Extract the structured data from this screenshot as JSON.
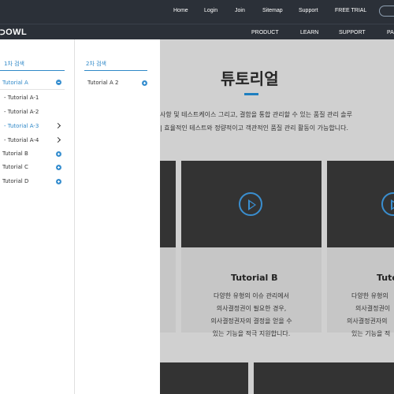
{
  "topbar": {
    "links": [
      "Home",
      "Login",
      "Join",
      "Sitemap",
      "Support",
      "FREE TRIAL"
    ]
  },
  "mainnav": {
    "logo": "OWL",
    "items": [
      "PRODUCT",
      "LEARN",
      "SUPPORT",
      "PA"
    ]
  },
  "page": {
    "title": "튜토리얼",
    "desc_line1": "사항 및 테스트케이스 그리고, 결함을 통합 관리할 수 있는 품질 관리 솔루",
    "desc_line2": "| 효율적인 테스트와 정량적이고 객관적인 품질 관리 활동이 가능합니다.",
    "cards": [
      {
        "title": "Tutorial B",
        "lines": [
          "다양한 유형의 이슈 관리에서",
          "의사결정권이 필요한 경우,",
          "의사결정권자의 결정을 얻을 수",
          "있는 기능을 적극 지원합니다."
        ]
      },
      {
        "title": "Tuto",
        "lines": [
          "다양한 유형의",
          "의사결정권이",
          "의사결정권자의",
          "있는 기능을 적"
        ]
      }
    ]
  },
  "menu1": {
    "heading": "1차 검색",
    "items": [
      {
        "label": "Tutorial A",
        "active": true,
        "icon": "minus-icon"
      },
      {
        "label": "- Tutorial A-1"
      },
      {
        "label": "- Tutorial A-2"
      },
      {
        "label": "- Tutorial A-3",
        "active": true,
        "icon": "chevron-right-icon"
      },
      {
        "label": "- Tutorial A-4",
        "icon": "chevron-right-icon"
      },
      {
        "label": "Tutorial B",
        "icon": "plus-icon"
      },
      {
        "label": "Tutorial C",
        "icon": "plus-icon"
      },
      {
        "label": "Tutorial D",
        "icon": "plus-icon"
      }
    ]
  },
  "menu2": {
    "heading": "2차 검색",
    "items": [
      {
        "label": "Tutorial A 2",
        "icon": "plus-icon"
      }
    ]
  },
  "colors": {
    "accent": "#2f88c8",
    "header_bg": "#2b3038"
  }
}
